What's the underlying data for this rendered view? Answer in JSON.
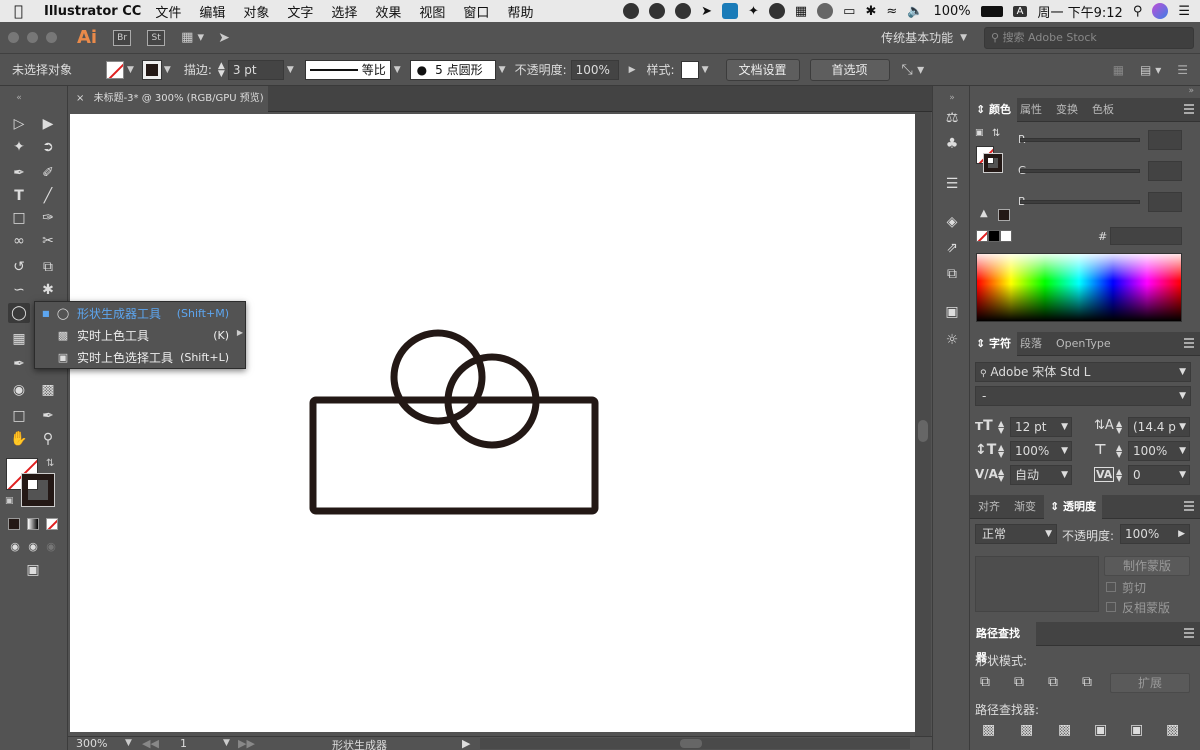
{
  "menubar": {
    "app_name": "Illustrator CC",
    "menus": [
      "文件",
      "编辑",
      "对象",
      "文字",
      "选择",
      "效果",
      "视图",
      "窗口",
      "帮助"
    ],
    "battery": "100%",
    "input_badge": "A",
    "clock": "周一 下午9:12"
  },
  "appbar": {
    "logo": "Ai",
    "bridge": "Br",
    "stock": "St",
    "workspace": "传统基本功能",
    "search_placeholder": "搜索 Adobe Stock"
  },
  "control": {
    "selection": "未选择对象",
    "stroke_label": "描边:",
    "stroke_value": "3 pt",
    "profile": "等比",
    "brush": "5 点圆形",
    "opacity_label": "不透明度:",
    "opacity_value": "100%",
    "style_label": "样式:",
    "doc_setup": "文档设置",
    "preferences": "首选项"
  },
  "document": {
    "tab_title": "未标题-3* @ 300% (RGB/GPU 预览)",
    "close": "×"
  },
  "flyout": {
    "items": [
      {
        "label": "形状生成器工具",
        "shortcut": "(Shift+M)",
        "active": true
      },
      {
        "label": "实时上色工具",
        "shortcut": "(K)",
        "active": false
      },
      {
        "label": "实时上色选择工具",
        "shortcut": "(Shift+L)",
        "active": false
      }
    ]
  },
  "color_panel": {
    "tabs": [
      "颜色",
      "属性",
      "变换",
      "色板"
    ],
    "channels": [
      "R",
      "G",
      "B"
    ],
    "hex_label": "#"
  },
  "char_panel": {
    "tabs": [
      "字符",
      "段落",
      "OpenType"
    ],
    "font": "Adobe 宋体 Std L",
    "style": "-",
    "size": "12 pt",
    "leading": "(14.4 p",
    "vscale": "100%",
    "hscale": "100%",
    "kerning": "自动",
    "tracking": "0"
  },
  "transparency_panel": {
    "tabs": [
      "对齐",
      "渐变",
      "透明度"
    ],
    "blend": "正常",
    "opacity_label": "不透明度:",
    "opacity_value": "100%",
    "make_mask": "制作蒙版",
    "clip": "剪切",
    "invert": "反相蒙版"
  },
  "pathfinder_panel": {
    "tab": "路径查找器",
    "shape_modes": "形状模式:",
    "expand": "扩展",
    "pathfinders": "路径查找器:"
  },
  "status": {
    "zoom": "300%",
    "artboard": "1",
    "tool": "形状生成器"
  },
  "colors": {
    "artwork_stroke": "#231815",
    "flyout_active": "#5da6f0",
    "logo": "#e98a4a"
  }
}
